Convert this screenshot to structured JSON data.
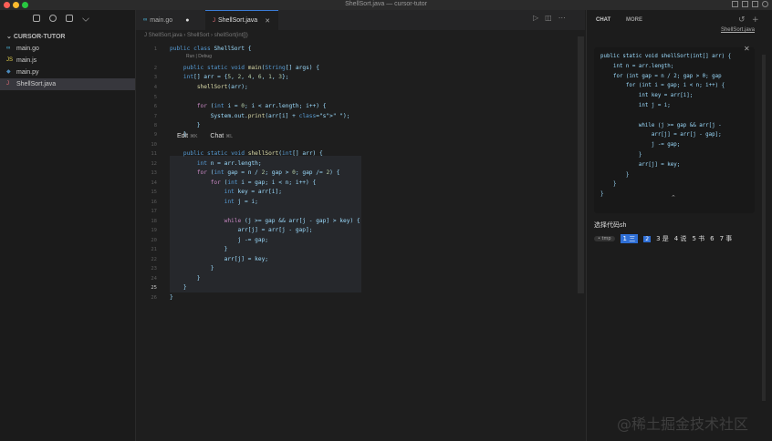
{
  "window": {
    "title": "ShellSort.java — cursor-tutor"
  },
  "sidebar": {
    "folder": "CURSOR-TUTOR",
    "files": [
      {
        "name": "main.go",
        "icon": "go-file-icon",
        "badge": "∞"
      },
      {
        "name": "main.js",
        "icon": "js-file-icon",
        "badge": "JS"
      },
      {
        "name": "main.py",
        "icon": "py-file-icon",
        "badge": "◆"
      },
      {
        "name": "ShellSort.java",
        "icon": "java-file-icon",
        "badge": "J",
        "active": true
      }
    ]
  },
  "tabs": [
    {
      "label": "main.go",
      "badge": "∞",
      "modified": true
    },
    {
      "label": "ShellSort.java",
      "badge": "J",
      "active": true
    }
  ],
  "breadcrumb": "J  ShellSort.java  ›  ShellSort  ›  shellSort(int[])",
  "codelens": "Run | Debug",
  "inline_bar": {
    "edit": "Edit",
    "edit_shortcut": "⌘K",
    "chat": "Chat",
    "chat_shortcut": "⌘L"
  },
  "editor": {
    "line_numbers": [
      "1",
      "2",
      "3",
      "4",
      "5",
      "6",
      "7",
      "8",
      "9",
      "10",
      "11",
      "12",
      "13",
      "14",
      "15",
      "16",
      "17",
      "18",
      "19",
      "20",
      "21",
      "22",
      "23",
      "24",
      "25",
      "26"
    ],
    "lines": [
      "public class ShellSort {",
      "    public static void main(String[] args) {",
      "    int[] arr = {5, 2, 4, 6, 1, 3};",
      "        shellSort(arr);",
      "",
      "        for (int i = 0; i < arr.length; i++) {",
      "            System.out.print(arr[i] + \" \");",
      "        }",
      "    }",
      "",
      "    public static void shellSort(int[] arr) {",
      "        int n = arr.length;",
      "        for (int gap = n / 2; gap > 0; gap /= 2) {",
      "            for (int i = gap; i < n; i++) {",
      "                int key = arr[i];",
      "                int j = i;",
      "",
      "                while (j >= gap && arr[j - gap] > key) {",
      "                    arr[j] = arr[j - gap];",
      "                    j -= gap;",
      "                }",
      "                arr[j] = key;",
      "            }",
      "        }",
      "    }",
      "}"
    ]
  },
  "chat": {
    "tab_chat": "CHAT",
    "tab_more": "MORE",
    "file_ref": "ShellSort.java",
    "code": "public static void shellSort(int[] arr) {\n    int n = arr.length;\n    for (int gap = n / 2; gap > 0; gap\n        for (int i = gap; i < n; i++) {\n            int key = arr[i];\n            int j = i;\n\n            while (j >= gap && arr[j -\n                arr[j] = arr[j - gap];\n                j -= gap;\n            }\n            arr[j] = key;\n        }\n    }\n}",
    "prompt": "选择代码sh",
    "ime_pill": "• tmp",
    "ime_candidates": [
      "1 三",
      "2",
      "3 是",
      "4 说",
      "5 书",
      "6",
      "7 事"
    ]
  },
  "watermark": "@稀土掘金技术社区"
}
